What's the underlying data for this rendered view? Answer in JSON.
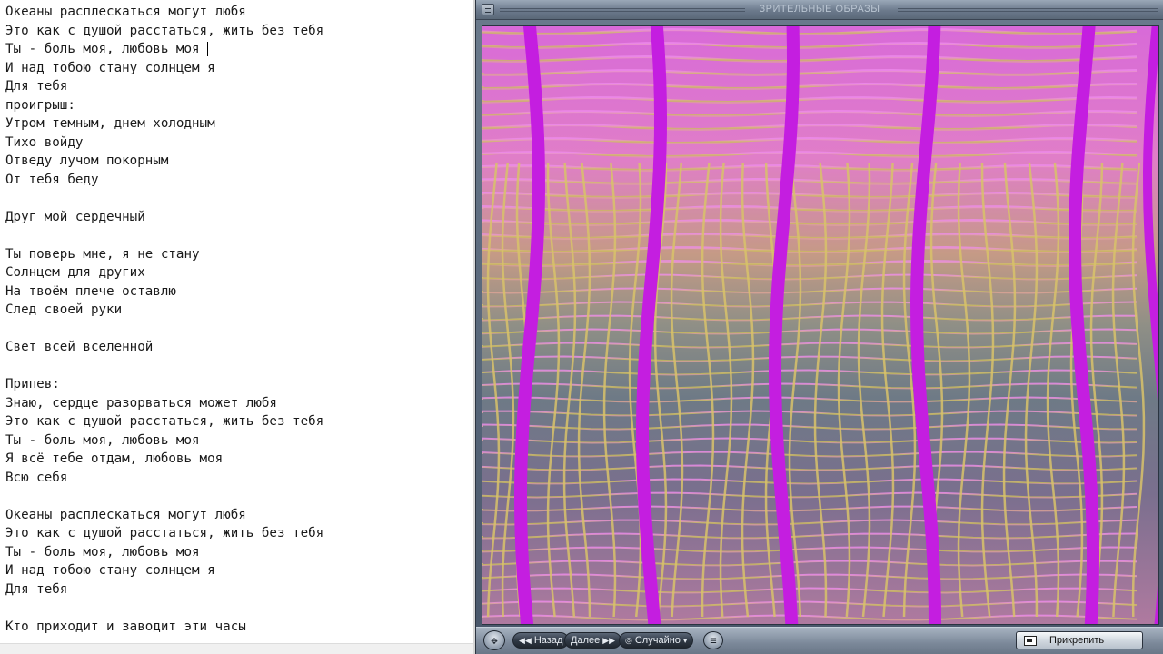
{
  "editor": {
    "lines": [
      "Океаны расплескаться могут любя",
      "Это как с душой расстаться, жить без тебя",
      "Ты - боль моя, любовь моя",
      "И над тобою стану солнцем я",
      "Для тебя",
      "проигрыш:",
      "Утром темным, днем холодным",
      "Тихо войду",
      "Отведу лучом покорным",
      "От тебя беду",
      "",
      "Друг мой сердечный",
      "",
      "Ты поверь мне, я не стану",
      "Солнцем для других",
      "На твоём плече оставлю",
      "След своей руки",
      "",
      "Свет всей вселенной",
      "",
      "Припев:",
      "Знаю, сердце разорваться может любя",
      "Это как с душой расстаться, жить без тебя",
      "Ты - боль моя, любовь моя",
      "Я всё тебе отдам, любовь моя",
      "Всю себя",
      "",
      "Океаны расплескаться могут любя",
      "Это как с душой расстаться, жить без тебя",
      "Ты - боль моя, любовь моя",
      "И над тобою стану солнцем я",
      "Для тебя",
      "",
      "Кто приходит и заводит эти часы"
    ],
    "caret_line": 2
  },
  "player": {
    "title": "ЗРИТЕЛЬНЫЕ ОБРАЗЫ",
    "controls": {
      "back_label": "Назад",
      "next_label": "Далее",
      "random_label": "Случайно",
      "pin_label": "Прикрепить"
    },
    "icons": {
      "move": "move-icon",
      "back": "rewind-icon",
      "next": "forward-icon",
      "random": "shuffle-icon",
      "options": "options-icon",
      "pin": "pin-icon"
    },
    "colors": {
      "stripe_magenta": "#c41ee0",
      "grid_top": "#e25ad8",
      "grid_mid": "#c9b06a",
      "grid_bottom_bg": "#6a6a8a",
      "frame": "#5a6878"
    }
  }
}
